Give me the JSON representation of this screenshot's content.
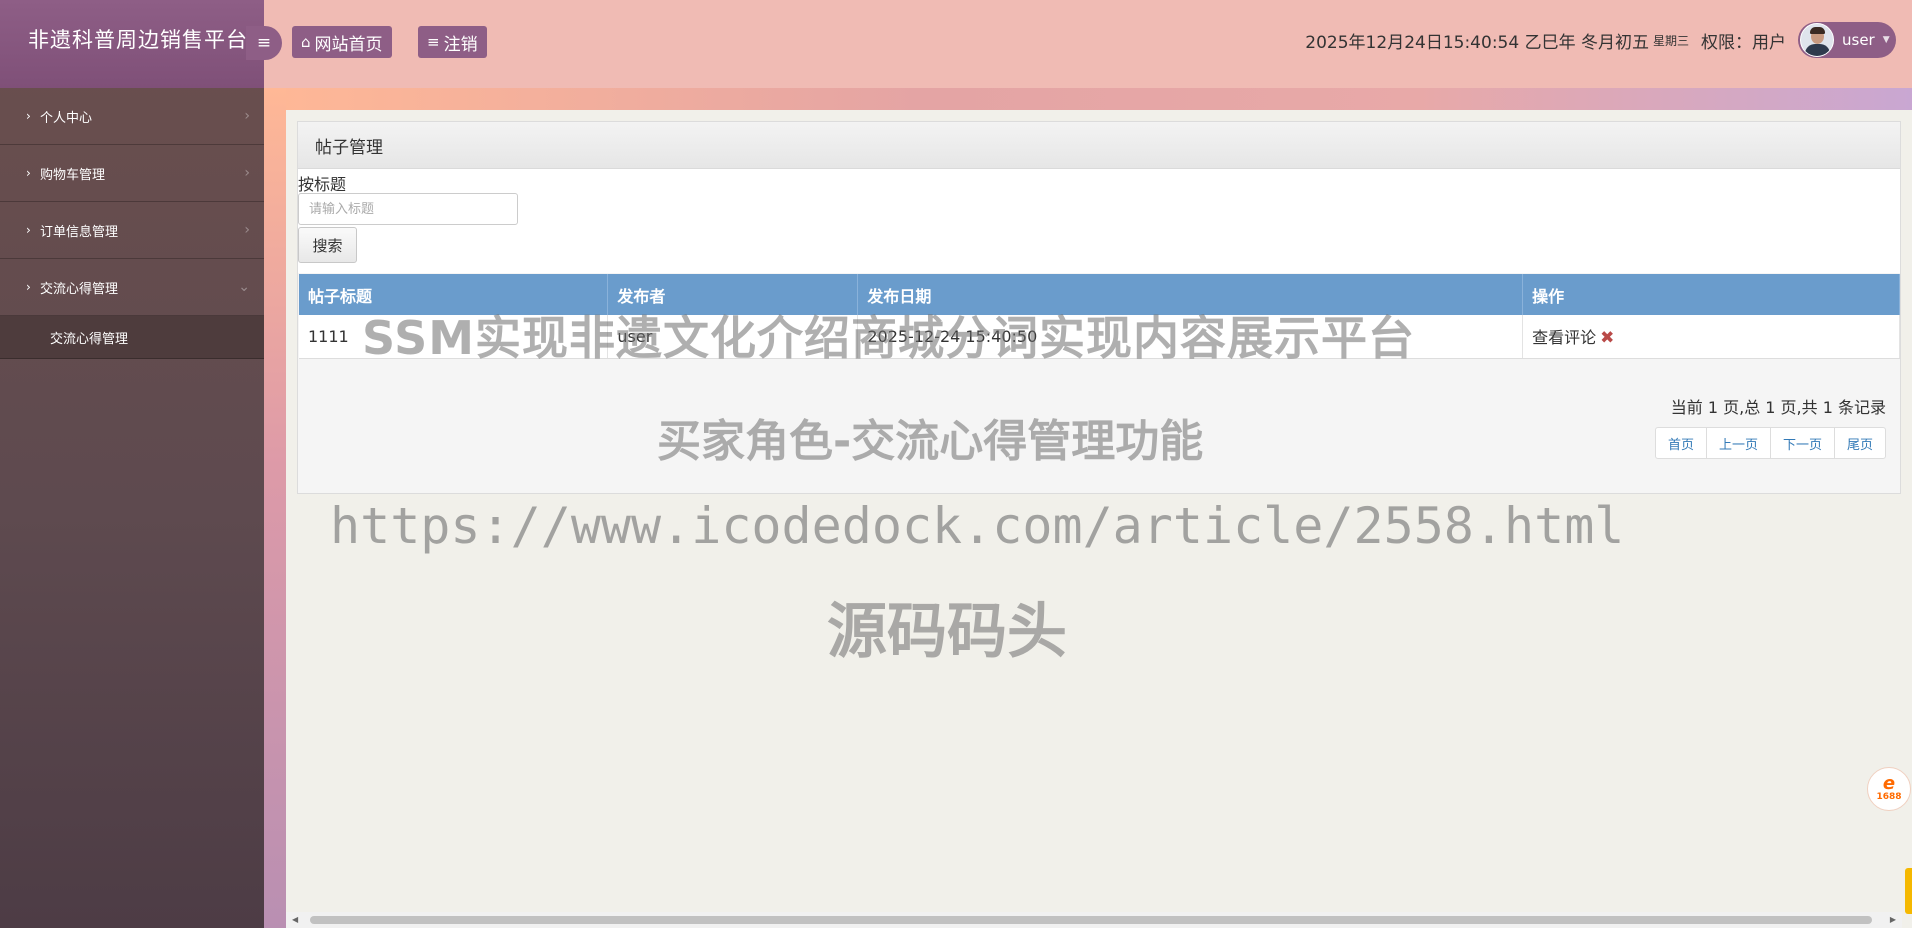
{
  "sidebar": {
    "brand": "非遗科普周边销售平台",
    "items": [
      {
        "label": "个人中心"
      },
      {
        "label": "购物车管理"
      },
      {
        "label": "订单信息管理"
      },
      {
        "label": "交流心得管理"
      }
    ],
    "submenu": [
      {
        "label": "交流心得管理"
      }
    ]
  },
  "topbar": {
    "home_label": "网站首页",
    "logout_label": "注销",
    "datetime": "2025年12月24日15:40:54 乙巳年 冬月初五",
    "weekday": "星期三",
    "permission": "权限：用户",
    "username": "user"
  },
  "panel": {
    "title": "帖子管理",
    "search": {
      "label": "按标题",
      "placeholder": "请输入标题",
      "value": "",
      "button": "搜索"
    },
    "table": {
      "headers": [
        "帖子标题",
        "发布者",
        "发布日期",
        "操作"
      ],
      "rows": [
        {
          "title": "1111",
          "author": "user",
          "date": "2025-12-24 15:40:50",
          "action": "查看评论"
        }
      ]
    },
    "pagination": {
      "info": "当前 1 页,总 1 页,共 1 条记录",
      "first": "首页",
      "prev": "上一页",
      "next": "下一页",
      "last": "尾页"
    }
  },
  "watermarks": {
    "line1": "SSM实现非遗文化介绍商城分词实现内容展示平台",
    "line2": "买家角色-交流心得管理功能",
    "line3": "https://www.icodedock.com/article/2558.html",
    "line4": "源码码头"
  },
  "widget": {
    "label": "1688"
  },
  "colors": {
    "accent": "#8e5e86",
    "topbar": "#f0bbb4",
    "table_header": "#6a9ccc",
    "link": "#337ab7",
    "delete": "#b94a48"
  }
}
